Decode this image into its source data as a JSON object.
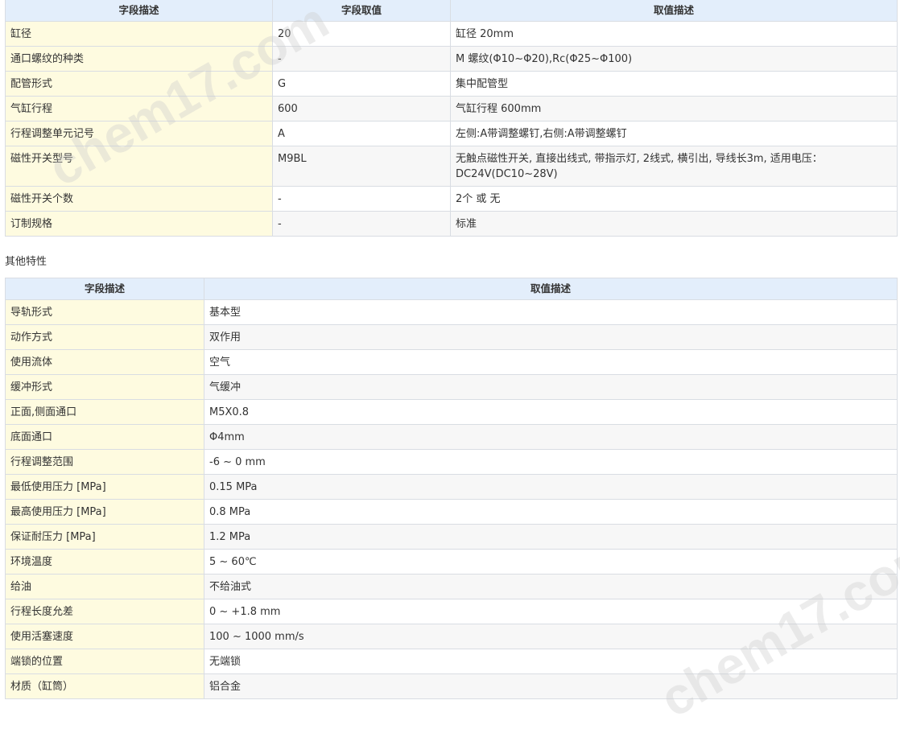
{
  "table1": {
    "headers": [
      "字段描述",
      "字段取值",
      "取值描述"
    ],
    "rows": [
      {
        "field": "缸径",
        "value": "20",
        "desc": "缸径 20mm"
      },
      {
        "field": "通口螺纹的种类",
        "value": "-",
        "desc": "M 螺纹(Φ10~Φ20),Rc(Φ25~Φ100)"
      },
      {
        "field": "配管形式",
        "value": "G",
        "desc": "集中配管型"
      },
      {
        "field": "气缸行程",
        "value": "600",
        "desc": "气缸行程 600mm"
      },
      {
        "field": "行程调整单元记号",
        "value": "A",
        "desc": "左侧:A带调整螺钉,右侧:A带调整螺钉"
      },
      {
        "field": "磁性开关型号",
        "value": "M9BL",
        "desc": "无触点磁性开关, 直接出线式, 带指示灯, 2线式, 横引出, 导线长3m, 适用电压：DC24V(DC10~28V)"
      },
      {
        "field": "磁性开关个数",
        "value": "-",
        "desc": "2个 或 无"
      },
      {
        "field": "订制规格",
        "value": "-",
        "desc": "标准"
      }
    ]
  },
  "section_title": "其他特性",
  "table2": {
    "headers": [
      "字段描述",
      "取值描述"
    ],
    "rows": [
      {
        "field": "导轨形式",
        "desc": "基本型"
      },
      {
        "field": "动作方式",
        "desc": "双作用"
      },
      {
        "field": "使用流体",
        "desc": "空气"
      },
      {
        "field": "缓冲形式",
        "desc": "气缓冲"
      },
      {
        "field": "正面,侧面通口",
        "desc": "M5X0.8"
      },
      {
        "field": "底面通口",
        "desc": "Φ4mm"
      },
      {
        "field": "行程调整范围",
        "desc": "-6 ~ 0 mm"
      },
      {
        "field": "最低使用压力 [MPa]",
        "desc": "0.15 MPa"
      },
      {
        "field": "最高使用压力 [MPa]",
        "desc": "0.8 MPa"
      },
      {
        "field": "保证耐压力 [MPa]",
        "desc": "1.2 MPa"
      },
      {
        "field": "环境温度",
        "desc": "5 ~ 60℃"
      },
      {
        "field": "给油",
        "desc": "不给油式"
      },
      {
        "field": "行程长度允差",
        "desc": "0 ~ +1.8 mm"
      },
      {
        "field": "使用活塞速度",
        "desc": "100 ~ 1000 mm/s"
      },
      {
        "field": "端锁的位置",
        "desc": "无端锁"
      },
      {
        "field": "材质（缸筒）",
        "desc": "铝合金"
      }
    ]
  },
  "watermark": "chem17.com"
}
